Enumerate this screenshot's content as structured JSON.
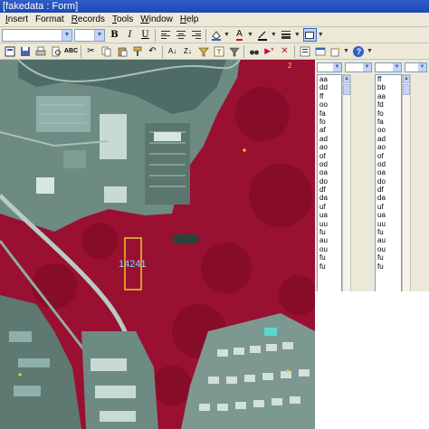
{
  "window": {
    "title": "[fakedata : Form]"
  },
  "menu": [
    {
      "key": "I",
      "rest": "nsert"
    },
    {
      "key": "",
      "rest": "Format"
    },
    {
      "key": "R",
      "rest": "ecords"
    },
    {
      "key": "T",
      "rest": "ools"
    },
    {
      "key": "W",
      "rest": "indow"
    },
    {
      "key": "H",
      "rest": "elp"
    }
  ],
  "formatting": {
    "bold": "B",
    "italic": "I",
    "underline": "U",
    "font_color_letter": "A"
  },
  "map": {
    "record_label": "14241",
    "corner_label": "2"
  },
  "panel": {
    "columns": [
      {
        "items": [
          "aa",
          "dd",
          "ff",
          "oo",
          "fa",
          "fo",
          "af",
          "ad",
          "ao",
          "of",
          "od",
          "oa",
          "do",
          "df",
          "da",
          "uf",
          "ua",
          "uu",
          "fu",
          "au",
          "ou",
          "fu",
          "fu"
        ]
      },
      {
        "items": [
          "ff",
          "bb",
          "aa",
          "fd",
          "fo",
          "fa",
          "oo",
          "ad",
          "ao",
          "of",
          "od",
          "oa",
          "do",
          "df",
          "da",
          "uf",
          "ua",
          "uu",
          "fu",
          "au",
          "ou",
          "fu",
          "fu"
        ]
      }
    ]
  },
  "colors": {
    "vegetation": "#9a1030",
    "pavement": "#5e7872",
    "title_bar": "#2f5fc7",
    "record_box": "#e8c82a",
    "record_label": "#7fd6ff"
  }
}
